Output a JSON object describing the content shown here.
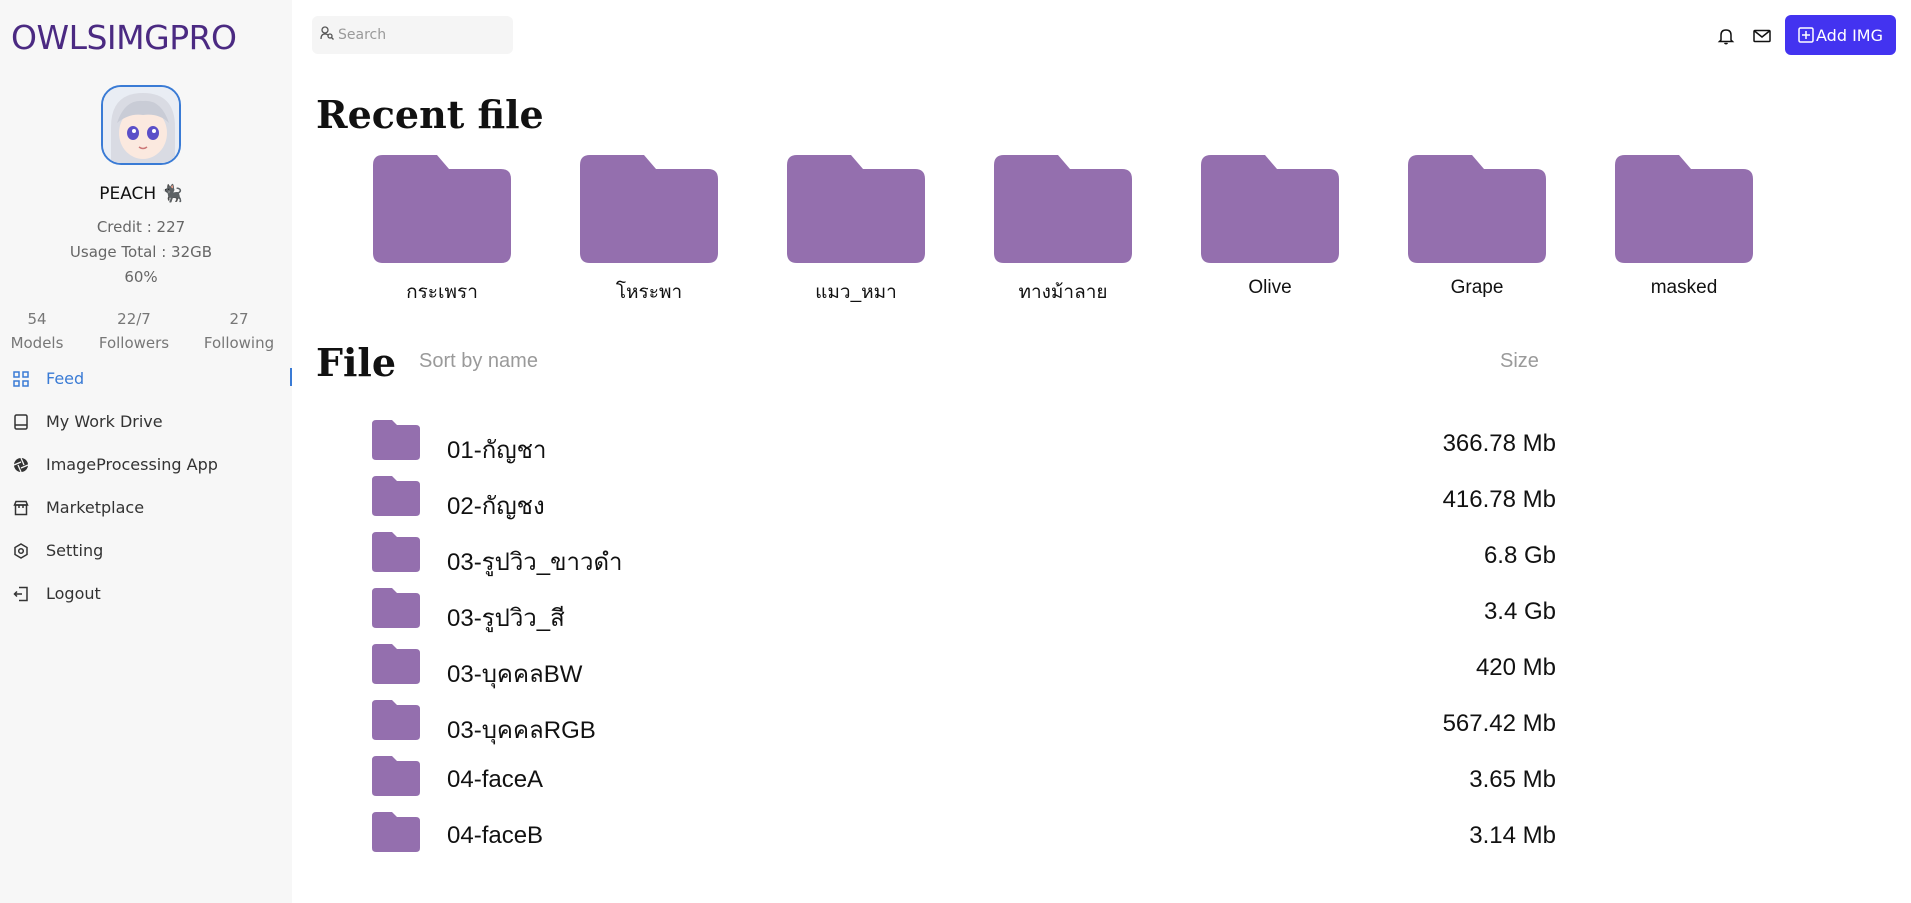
{
  "app": {
    "brand": "OWLSIMGPRO"
  },
  "profile": {
    "name": "PEACH 🐈‍⬛",
    "credit": "Credit : 227",
    "usage": "Usage Total : 32GB",
    "usage_percent": "60%"
  },
  "stats": [
    {
      "value": "54",
      "label": "Models"
    },
    {
      "value": "22/7",
      "label": "Followers"
    },
    {
      "value": "27",
      "label": "Following"
    }
  ],
  "nav": [
    {
      "label": "Feed",
      "icon": "grid-icon",
      "active": true
    },
    {
      "label": "My Work Drive",
      "icon": "drive-icon"
    },
    {
      "label": "ImageProcessing App",
      "icon": "aperture-icon"
    },
    {
      "label": "Marketplace",
      "icon": "store-icon"
    },
    {
      "label": "Setting",
      "icon": "hexagon-settings-icon"
    },
    {
      "label": "Logout",
      "icon": "logout-icon"
    }
  ],
  "topbar": {
    "search_placeholder": "Search",
    "add_button": "Add IMG"
  },
  "recent": {
    "title": "Recent file",
    "folders": [
      "กระเพรา",
      "โหระพา",
      "แมว_หมา",
      "ทางม้าลาย",
      "Olive",
      "Grape",
      "masked"
    ]
  },
  "files": {
    "title": "File",
    "sort_label": "Sort by name",
    "size_header": "Size",
    "rows": [
      {
        "name": "01-กัญชา",
        "size": "366.78 Mb"
      },
      {
        "name": "02-กัญชง",
        "size": "416.78 Mb"
      },
      {
        "name": "03-รูปวิว_ขาวดำ",
        "size": "6.8 Gb"
      },
      {
        "name": "03-รูปวิว_สี",
        "size": "3.4 Gb"
      },
      {
        "name": "03-บุคคลBW",
        "size": "420 Mb"
      },
      {
        "name": "03-บุคคลRGB",
        "size": "567.42 Mb"
      },
      {
        "name": "04-faceA",
        "size": "3.65 Mb"
      },
      {
        "name": "04-faceB",
        "size": "3.14 Mb"
      }
    ]
  },
  "colors": {
    "folder": "#946fae",
    "accent": "#4333f0",
    "brand": "#4b2a82",
    "active": "#3a7bd5"
  }
}
